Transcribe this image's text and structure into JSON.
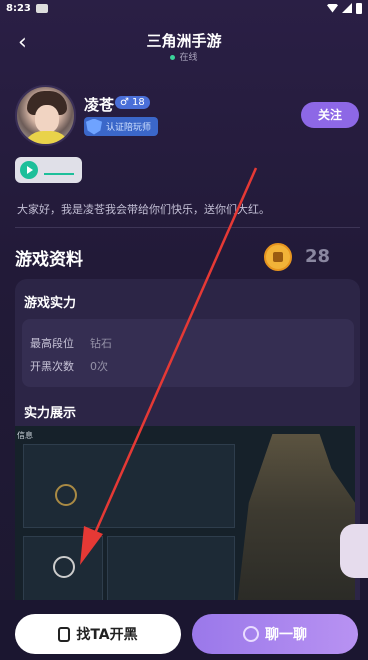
{
  "status": {
    "time": "8:23"
  },
  "nav": {
    "title": "三角洲手游",
    "status": "在线"
  },
  "profile": {
    "name": "凌苍",
    "gender_age": "18",
    "badge_text": "认证陪玩师",
    "follow_label": "关注",
    "bio": "大家好，我是凌苍我会带给你们快乐，送你们大红。"
  },
  "game_section": {
    "title": "游戏资料",
    "coin_count": "28",
    "strength_title": "游戏实力",
    "rows": [
      {
        "label": "最高段位",
        "value": "钻石"
      },
      {
        "label": "开黑次数",
        "value": "0次"
      }
    ],
    "show_title": "实力展示",
    "screenshot_label": "信息"
  },
  "actions": {
    "find_label": "找TA开黑",
    "chat_label": "聊一聊"
  },
  "colors": {
    "accent": "#8d68e6",
    "arrow": "#e53935"
  }
}
